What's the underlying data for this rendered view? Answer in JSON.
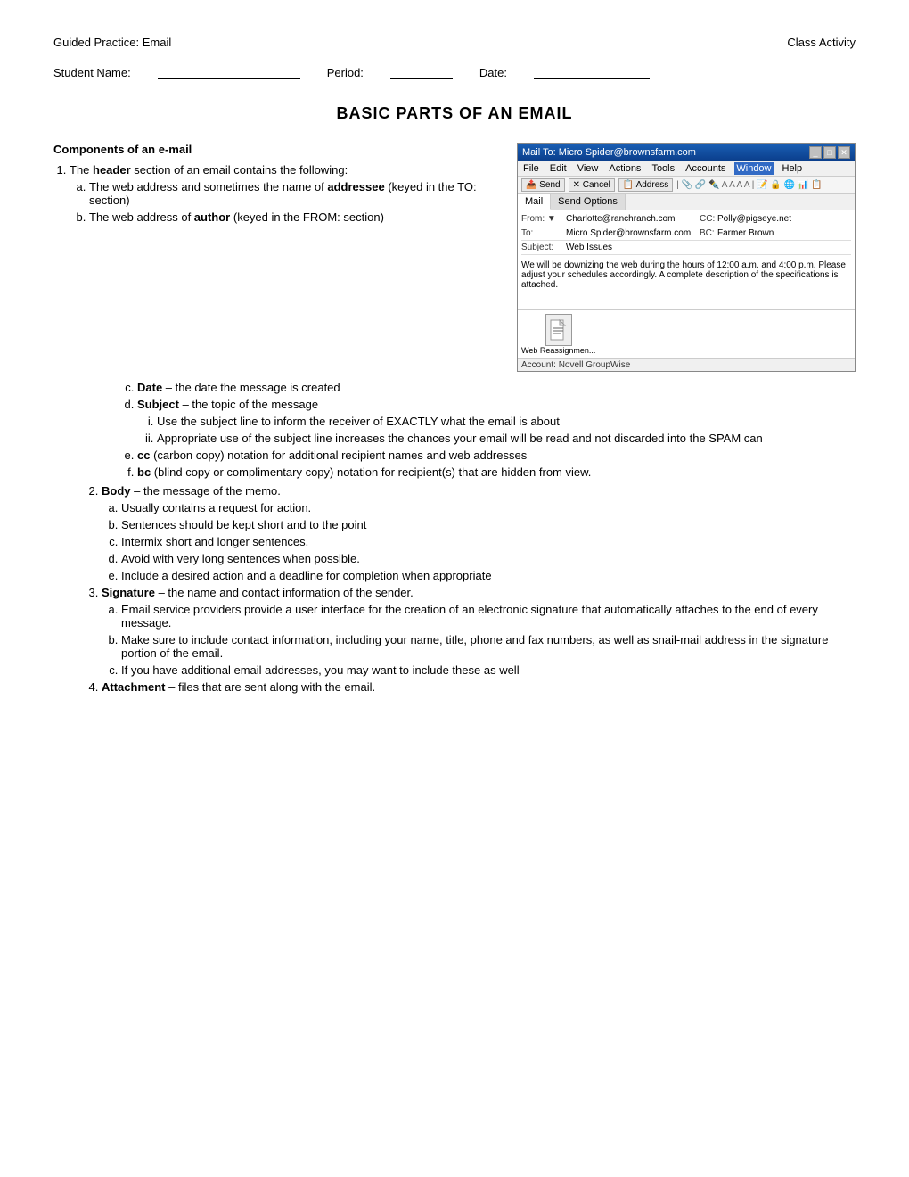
{
  "header": {
    "left": "Guided Practice:  Email",
    "right": "Class Activity"
  },
  "student_row": {
    "name_label": "Student Name:",
    "period_label": "Period:",
    "date_label": "Date:"
  },
  "page_title": "Basic Parts of an Email",
  "components_heading": "Components of an e-mail",
  "main_list": [
    {
      "number": "1",
      "text_before_bold": "The ",
      "bold": "header",
      "text_after_bold": " section of an email contains the following:",
      "sub_items_alpha": [
        {
          "letter": "a",
          "text": "The web address and sometimes the name of ",
          "bold": "addressee",
          "text_after": " (keyed in the TO: section)"
        },
        {
          "letter": "b",
          "text": "The web address of ",
          "bold": "author",
          "text_after": " (keyed in the FROM: section)"
        },
        {
          "letter": "c",
          "bold": "Date",
          "text_after": " – the date the message is created"
        },
        {
          "letter": "d",
          "bold": "Subject",
          "text_after": " – the topic of the message",
          "sub_items_roman": [
            {
              "roman": "i",
              "text": "Use the subject line to inform the receiver of EXACTLY what the email is about"
            },
            {
              "roman": "ii",
              "text": "Appropriate use of the subject line increases the chances your email will be read and not discarded into the SPAM can"
            }
          ]
        },
        {
          "letter": "e",
          "bold": "cc",
          "text_after": " (carbon copy) notation for additional recipient names and web addresses"
        },
        {
          "letter": "f",
          "bold": "bc",
          "text_after": " (blind copy or complimentary copy) notation for recipient(s) that are hidden from view."
        }
      ]
    }
  ],
  "main_list_continued": [
    {
      "number": "2",
      "bold": "Body",
      "text_after": " – the message of the memo.",
      "sub_items_alpha": [
        {
          "text": "Usually contains a request for action."
        },
        {
          "text": "Sentences should be kept short and to the point"
        },
        {
          "text": "Intermix short and longer sentences."
        },
        {
          "text": "Avoid with very long sentences when possible."
        },
        {
          "text": "Include a desired action and a deadline for completion when appropriate"
        }
      ]
    },
    {
      "number": "3",
      "bold": "Signature",
      "text_after": " – the name and contact information of the sender.",
      "sub_items_alpha": [
        {
          "text": "Email service providers provide a user interface for the creation of an electronic signature that automatically attaches to the end of every message."
        },
        {
          "text": "Make sure to include contact information, including your name, title, phone and fax numbers, as well as snail-mail address in the signature portion of the email."
        },
        {
          "text": "If you have additional email addresses, you may want to include these as well"
        }
      ]
    },
    {
      "number": "4",
      "bold": "Attachment",
      "text_after": " – files that are sent along with the email."
    }
  ],
  "email_window": {
    "titlebar": "Mail To: Micro Spider@brownsfarm.com",
    "menubar": [
      "File",
      "Edit",
      "View",
      "Actions",
      "Tools",
      "Accounts",
      "Window",
      "Help"
    ],
    "active_menu": "Window",
    "tabs": [
      "Mail",
      "Send Options"
    ],
    "active_tab": "Mail",
    "fields": {
      "from_label": "From:",
      "from_value": "Charlotte@ranchranch.com",
      "to_label": "To:",
      "to_value": "Micro Spider@brownsfarm.com",
      "subject_label": "Subject:",
      "subject_value": "Web Issues",
      "cc_label": "CC:",
      "cc_value": "Polly@pigseye.net",
      "bc_label": "BC:",
      "bc_value": "Farmer Brown"
    },
    "body_text": "We will be downizing the web during the hours of 12:00 a.m. and 4:00 p.m. Please adjust your schedules accordingly. A complete description of the specifications is attached.",
    "attachment_label": "Web Reassignmen...",
    "status_bar": "Account: Novell GroupWise"
  }
}
